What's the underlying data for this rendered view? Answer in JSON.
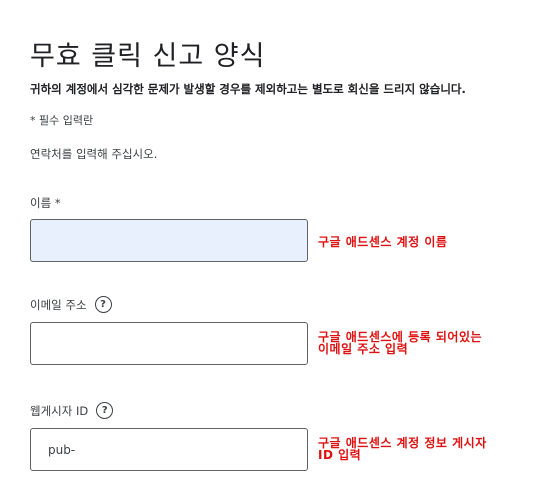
{
  "form": {
    "title": "무효 클릭 신고 양식",
    "notice": "귀하의 계정에서 심각한 문제가 발생할 경우를 제외하고는 별도로 회신을 드리지 않습니다.",
    "required_note": "* 필수 입력란",
    "instruction": "연락처를 입력해 주십시오."
  },
  "fields": {
    "name": {
      "label": "이름 *",
      "value": "",
      "annotation": "구글 애드센스 계정 이름"
    },
    "email": {
      "label": "이메일 주소",
      "help_icon": "?",
      "value": "",
      "annotation_line1": "구글 애드센스에 등록 되어있는",
      "annotation_line2": "이메일 주소 입력"
    },
    "publisher_id": {
      "label": "웹게시자 ID",
      "help_icon": "?",
      "value": "pub-",
      "annotation_line1": "구글 애드센스 계정 정보 게시자",
      "annotation_line2": "ID 입력"
    }
  },
  "colors": {
    "annotation": "#e01010",
    "autofill_background": "#e8f0fe",
    "text": "#202124"
  }
}
